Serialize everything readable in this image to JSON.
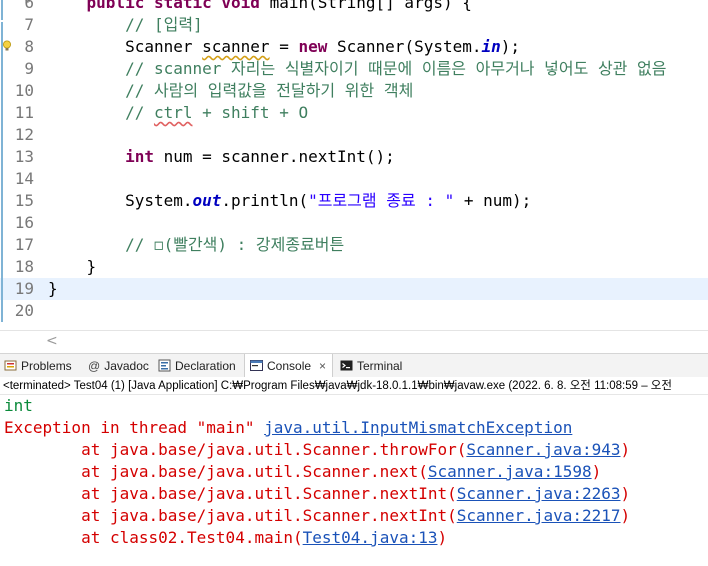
{
  "editor": {
    "lines": [
      {
        "num": "6",
        "tokens": [
          [
            "    ",
            ""
          ],
          [
            "public",
            "kw"
          ],
          [
            " ",
            ""
          ],
          [
            "static",
            "kw"
          ],
          [
            " ",
            ""
          ],
          [
            "void",
            "kw"
          ],
          [
            " main(String[] args) {",
            ""
          ]
        ],
        "fold": true
      },
      {
        "num": "7",
        "tokens": [
          [
            "        ",
            ""
          ],
          [
            "// [입력]",
            "cm"
          ]
        ]
      },
      {
        "num": "8",
        "tokens": [
          [
            "        Scanner ",
            ""
          ],
          [
            "scanner",
            "sq"
          ],
          [
            " = ",
            ""
          ],
          [
            "new",
            "kw"
          ],
          [
            " Scanner(System.",
            ""
          ],
          [
            "in",
            "fld"
          ],
          [
            ");",
            ""
          ]
        ],
        "warning": true
      },
      {
        "num": "9",
        "tokens": [
          [
            "        ",
            ""
          ],
          [
            "// scanner 자리는 식별자이기 때문에 이름은 아무거나 넣어도 상관 없음",
            "cm"
          ]
        ]
      },
      {
        "num": "10",
        "tokens": [
          [
            "        ",
            ""
          ],
          [
            "// 사람의 입력값을 전달하기 위한 객체",
            "cm"
          ]
        ]
      },
      {
        "num": "11",
        "tokens": [
          [
            "        ",
            ""
          ],
          [
            "// ",
            "cm"
          ],
          [
            "ctrl",
            "cm sqr"
          ],
          [
            " + shift + O",
            "cm"
          ]
        ]
      },
      {
        "num": "12",
        "tokens": []
      },
      {
        "num": "13",
        "tokens": [
          [
            "        ",
            ""
          ],
          [
            "int",
            "kw"
          ],
          [
            " num = scanner.nextInt();",
            ""
          ]
        ]
      },
      {
        "num": "14",
        "tokens": []
      },
      {
        "num": "15",
        "tokens": [
          [
            "        System.",
            ""
          ],
          [
            "out",
            "fld"
          ],
          [
            ".println(",
            ""
          ],
          [
            "\"프로그램 종료 : \"",
            "st"
          ],
          [
            " + num);",
            ""
          ]
        ]
      },
      {
        "num": "16",
        "tokens": []
      },
      {
        "num": "17",
        "tokens": [
          [
            "        ",
            ""
          ],
          [
            "// ◻(빨간색) : 강제종료버튼",
            "cm"
          ]
        ]
      },
      {
        "num": "18",
        "tokens": [
          [
            "    }",
            ""
          ]
        ]
      },
      {
        "num": "19",
        "tokens": [
          [
            "}",
            ""
          ]
        ],
        "current": true
      },
      {
        "num": "20",
        "tokens": []
      }
    ]
  },
  "scrollbar": {
    "left_arrow": "<"
  },
  "tabs": [
    {
      "label": "Problems",
      "icon": "problems-icon"
    },
    {
      "label": "Javadoc",
      "icon": "at-icon"
    },
    {
      "label": "Declaration",
      "icon": "declaration-icon"
    },
    {
      "label": "Console",
      "icon": "console-icon",
      "active": true,
      "close": "×"
    },
    {
      "label": "Terminal",
      "icon": "terminal-icon"
    }
  ],
  "status": "<terminated> Test04 (1) [Java Application] C:₩Program Files₩java₩jdk-18.0.1.1₩bin₩javaw.exe  (2022. 6. 8. 오전 11:08:59 – 오전",
  "console": {
    "input": "int",
    "exception_prefix": "Exception in thread \"main\" ",
    "exception_class": "java.util.InputMismatchException",
    "trace": [
      {
        "at": "        at java.base/java.util.Scanner.throwFor(",
        "link": "Scanner.java:943",
        "end": ")"
      },
      {
        "at": "        at java.base/java.util.Scanner.next(",
        "link": "Scanner.java:1598",
        "end": ")"
      },
      {
        "at": "        at java.base/java.util.Scanner.nextInt(",
        "link": "Scanner.java:2263",
        "end": ")"
      },
      {
        "at": "        at java.base/java.util.Scanner.nextInt(",
        "link": "Scanner.java:2217",
        "end": ")"
      },
      {
        "at": "        at class02.Test04.main(",
        "link": "Test04.java:13",
        "end": ")"
      }
    ]
  },
  "colors": {
    "keyword": "#7f0055",
    "comment": "#3f7f5f",
    "string": "#2a00ff",
    "error": "#d40000",
    "link": "#1a52b8",
    "input": "#0a8a3a",
    "current_line": "#e8f2fe"
  }
}
